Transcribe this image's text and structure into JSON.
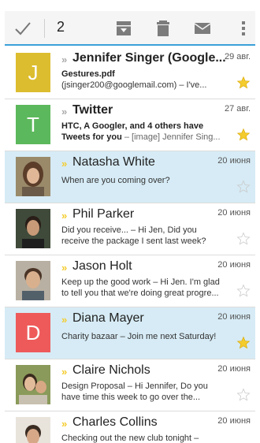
{
  "toolbar": {
    "selected_count": "2",
    "icons": [
      "checkmark-icon",
      "archive-icon",
      "trash-icon",
      "mail-icon",
      "overflow-menu-icon"
    ]
  },
  "colors": {
    "accent": "#3aa0d8",
    "selected_row": "#d6ebf5",
    "star_on": "#f4cc2e",
    "avatar_yellow": "#dcbd2f",
    "avatar_green": "#5cb85c",
    "avatar_red": "#ee5a5a"
  },
  "emails": [
    {
      "marker": "»",
      "sender": "Jennifer Singer (Google...",
      "date": "29 авг.",
      "subject": "Gestures.pdf",
      "snippet": "(jsinger200@googlemail.com) – I've...",
      "avatar_letter": "J",
      "starred": true
    },
    {
      "marker": "»",
      "sender": "Twitter",
      "date": "27 авг.",
      "subject": "HTC, A Googler, and 4 others have",
      "snippet_bold": "Tweets for you",
      "snippet": " – [image] Jennifer Sing...",
      "avatar_letter": "T",
      "starred": true
    },
    {
      "marker": "»",
      "sender": "Natasha White",
      "date": "20 июня",
      "line1": "When are you coming over?",
      "avatar": "photo",
      "starred": false
    },
    {
      "marker": "»",
      "sender": "Phil Parker",
      "date": "20 июня",
      "line1": "Did you receive... – Hi Jen, Did you",
      "line2": "receive the package I sent last week?",
      "avatar": "photo",
      "starred": false
    },
    {
      "marker": "»",
      "sender": "Jason Holt",
      "date": "20 июня",
      "line1": "Keep up the good work – Hi Jen. I'm glad",
      "line2": "to tell you that we're doing great progre...",
      "avatar": "photo",
      "starred": false
    },
    {
      "marker": "»",
      "sender": "Diana Mayer",
      "date": "20 июня",
      "line1": "Charity bazaar – Join me next Saturday!",
      "avatar_letter": "D",
      "starred": true
    },
    {
      "marker": "»",
      "sender": "Claire Nichols",
      "date": "20 июня",
      "line1": "Design Proposal – Hi Jennifer, Do you",
      "line2": "have time this week to go over the...",
      "avatar": "photo",
      "starred": false
    },
    {
      "marker": "»",
      "sender": "Charles Collins",
      "date": "20 июня",
      "line1": "Checking out the new club tonight –",
      "avatar": "photo",
      "starred": false
    }
  ]
}
